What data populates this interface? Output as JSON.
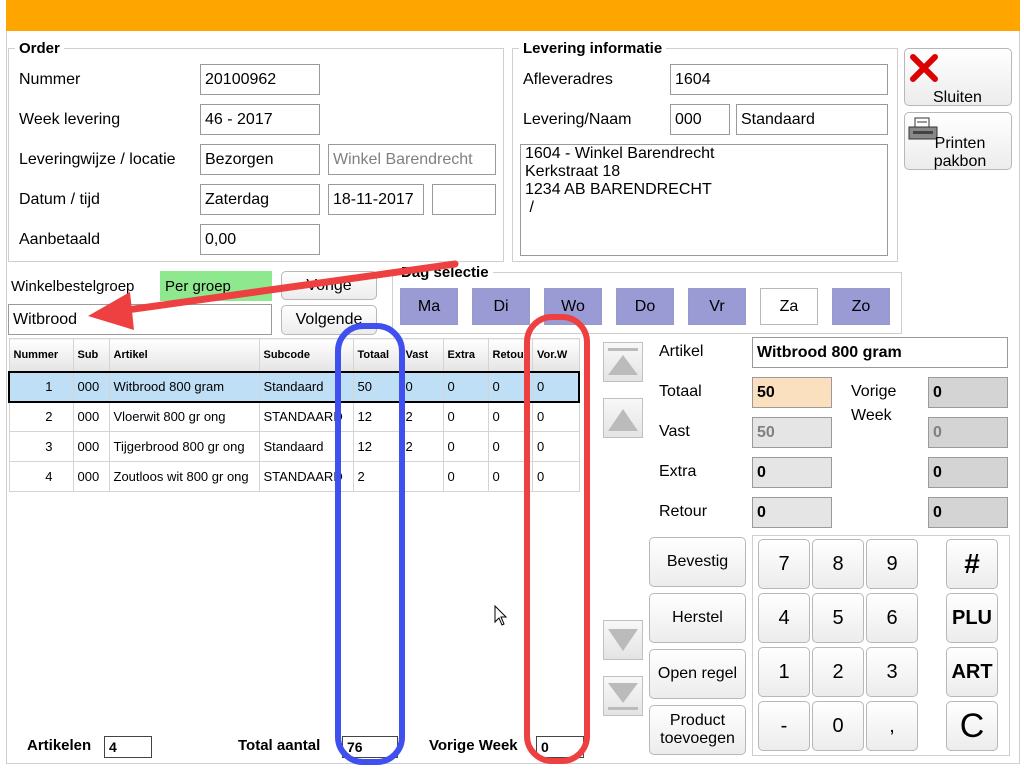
{
  "order": {
    "legend": "Order",
    "nummer_label": "Nummer",
    "nummer": "20100962",
    "week_label": "Week levering",
    "week": "46 - 2017",
    "wijze_label": "Leveringwijze / locatie",
    "wijze": "Bezorgen",
    "locatie": "Winkel Barendrecht",
    "datum_label": "Datum / tijd",
    "dag": "Zaterdag",
    "datum": "18-11-2017",
    "tijd": "",
    "aanbetaald_label": "Aanbetaald",
    "aanbetaald": "0,00"
  },
  "levering": {
    "legend": "Levering informatie",
    "adres_label": "Afleveradres",
    "adres": "1604",
    "naam_label": "Levering/Naam",
    "code": "000",
    "naam": "Standaard",
    "address_lines": [
      "1604 - Winkel Barendrecht",
      "Kerkstraat 18",
      "1234 AB BARENDRECHT",
      " /"
    ]
  },
  "actions": {
    "sluiten": "Sluiten",
    "printen": "Printen pakbon"
  },
  "winkel": {
    "label": "Winkelbestelgroep",
    "per_groep": "Per groep",
    "groep": "Witbrood",
    "vorige": "Vorige",
    "volgende": "Volgende"
  },
  "dag_selectie": {
    "legend": "Dag selectie",
    "days": [
      "Ma",
      "Di",
      "Wo",
      "Do",
      "Vr",
      "Za",
      "Zo"
    ]
  },
  "table": {
    "columns": [
      "Nummer",
      "Sub",
      "Artikel",
      "Subcode",
      "Totaal",
      "Vast",
      "Extra",
      "Retour",
      "Vor.W"
    ],
    "rows": [
      [
        "1",
        "000",
        "Witbrood 800 gram",
        "Standaard",
        "50",
        "0",
        "0",
        "0",
        "0"
      ],
      [
        "2",
        "000",
        "Vloerwit 800 gr ong",
        "STANDAARD",
        "12",
        "2",
        "0",
        "0",
        "0"
      ],
      [
        "3",
        "000",
        "Tijgerbrood 800 gr ong",
        "Standaard",
        "12",
        "2",
        "0",
        "0",
        "0"
      ],
      [
        "4",
        "000",
        "Zoutloos wit 800 gr ong",
        "STANDAARD",
        "2",
        "",
        "0",
        "0",
        "0"
      ]
    ]
  },
  "detail": {
    "artikel_label": "Artikel",
    "artikel": "Witbrood 800 gram",
    "totaal_label": "Totaal",
    "totaal": "50",
    "vorige_label_1": "Vorige",
    "vorige_label_2": "Week",
    "vorige_totaal": "0",
    "vast_label": "Vast",
    "vast": "50",
    "vorige_vast": "0",
    "extra_label": "Extra",
    "extra": "0",
    "vorige_extra": "0",
    "retour_label": "Retour",
    "retour": "0",
    "vorige_retour": "0"
  },
  "keypad": {
    "bevestig": "Bevestig",
    "herstel": "Herstel",
    "open_regel": "Open regel",
    "product_1": "Product",
    "product_2": "toevoegen",
    "keys": [
      "7",
      "8",
      "9",
      "4",
      "5",
      "6",
      "1",
      "2",
      "3",
      "-",
      "0",
      ","
    ],
    "specials": [
      "#",
      "PLU",
      "ART",
      "C"
    ]
  },
  "footer": {
    "artikelen_label": "Artikelen",
    "artikelen": "4",
    "total_label": "Total aantal",
    "total": "76",
    "vorige_label": "Vorige Week",
    "vorige": "0"
  },
  "colors": {
    "topbar": "#ffa500",
    "day_active": "#9a9ad4",
    "selected_row": "#bfdff7",
    "annotation_blue": "#4050ee",
    "annotation_red": "#ee4040",
    "arrow": "#ee4040",
    "close": "#dd0000"
  }
}
